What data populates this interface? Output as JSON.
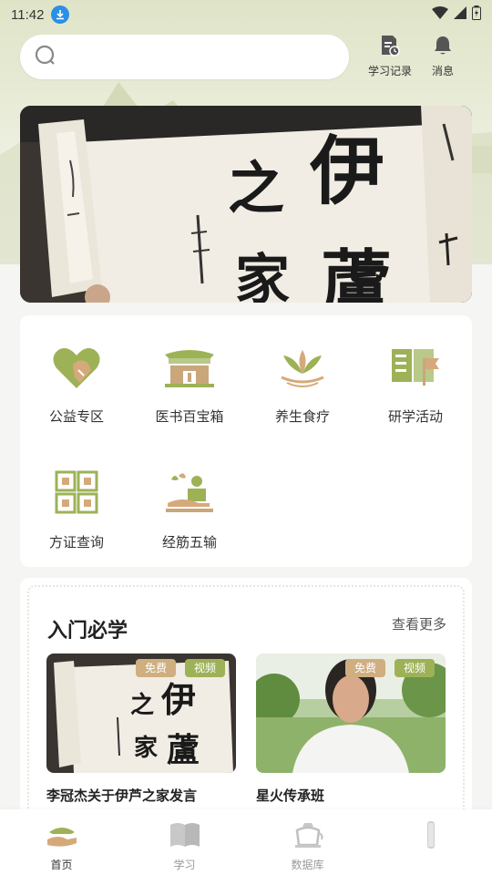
{
  "status_bar": {
    "time": "11:42"
  },
  "header": {
    "search": {
      "placeholder": ""
    },
    "study_record_label": "学习记录",
    "messages_label": "消息"
  },
  "banner": {
    "chars_left": "之",
    "chars_right": "伊",
    "chars_bottom_left": "家",
    "chars_bottom_right": "蘆"
  },
  "categories": [
    {
      "label": "公益专区",
      "icon": "heart-hands-icon"
    },
    {
      "label": "医书百宝箱",
      "icon": "pavilion-icon"
    },
    {
      "label": "养生食疗",
      "icon": "lotus-icon"
    },
    {
      "label": "研学活动",
      "icon": "book-flag-icon"
    },
    {
      "label": "方证查询",
      "icon": "grid-boxes-icon"
    },
    {
      "label": "经筋五输",
      "icon": "massage-icon"
    }
  ],
  "section": {
    "title": "入门必学",
    "more_label": "查看更多",
    "courses": [
      {
        "title": "李冠杰关于伊芦之家发言",
        "tag_free": "免费",
        "tag_video": "视频"
      },
      {
        "title": "星火传承班",
        "tag_free": "免费",
        "tag_video": "视频"
      }
    ]
  },
  "bottom_nav": [
    {
      "label": "首页",
      "active": true
    },
    {
      "label": "学习",
      "active": false
    },
    {
      "label": "数据库",
      "active": false
    },
    {
      "label": "",
      "active": false
    }
  ],
  "colors": {
    "accent": "#9db257",
    "tag_free": "#cfae80",
    "icon_brown": "#c9a77a"
  }
}
